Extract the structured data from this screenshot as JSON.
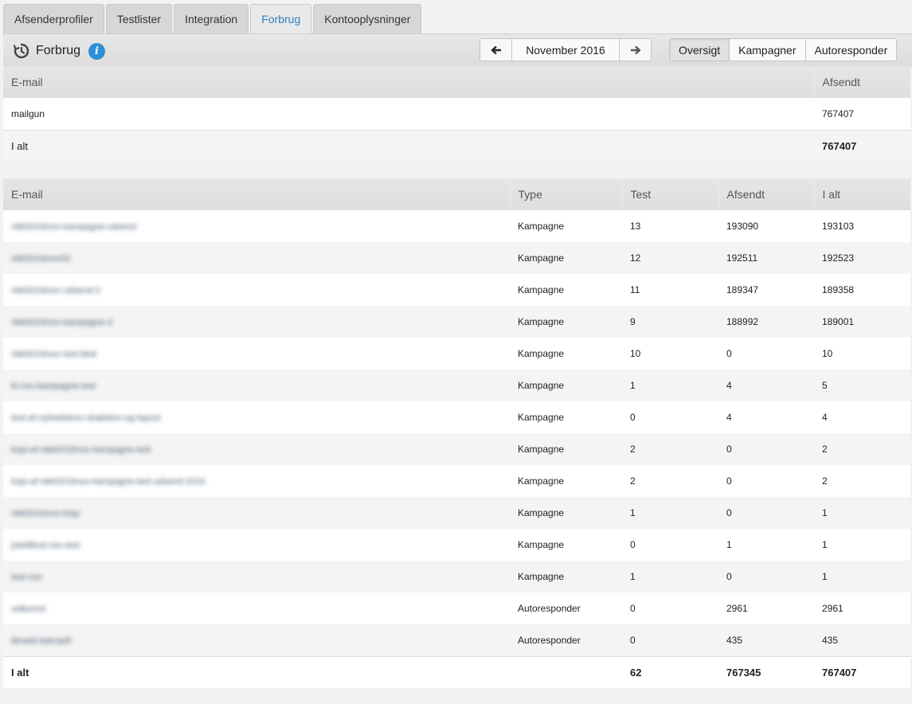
{
  "tabs": [
    {
      "label": "Afsenderprofiler",
      "active": false
    },
    {
      "label": "Testlister",
      "active": false
    },
    {
      "label": "Integration",
      "active": false
    },
    {
      "label": "Forbrug",
      "active": true
    },
    {
      "label": "Kontooplysninger",
      "active": false
    }
  ],
  "toolbar": {
    "title": "Forbrug",
    "info_icon": "i",
    "month": "November 2016",
    "prev_arrow": "🡐",
    "next_arrow": "🡒",
    "views": [
      {
        "label": "Oversigt",
        "active": true
      },
      {
        "label": "Kampagner",
        "active": false
      },
      {
        "label": "Autoresponder",
        "active": false
      }
    ]
  },
  "senders_table": {
    "headers": {
      "email": "E-mail",
      "sent": "Afsendt"
    },
    "rows": [
      {
        "email": "mailgun",
        "sent": "767407"
      }
    ],
    "total": {
      "label": "I alt",
      "sent": "767407"
    }
  },
  "usage_table": {
    "headers": {
      "email": "E-mail",
      "type": "Type",
      "test": "Test",
      "sent": "Afsendt",
      "total": "I alt"
    },
    "rows": [
      {
        "email": "nbkl2016nov-kampagne-udsend",
        "type": "Kampagne",
        "test": "13",
        "sent": "193090",
        "total": "193103"
      },
      {
        "email": "nbkl2016nov02",
        "type": "Kampagne",
        "test": "12",
        "sent": "192511",
        "total": "192523"
      },
      {
        "email": "nbkl2016nov-udsend-3",
        "type": "Kampagne",
        "test": "11",
        "sent": "189347",
        "total": "189358"
      },
      {
        "email": "nbkl2016nov-kampagne-4",
        "type": "Kampagne",
        "test": "9",
        "sent": "188992",
        "total": "189001"
      },
      {
        "email": "nbkl2016nov-test-blok",
        "type": "Kampagne",
        "test": "10",
        "sent": "0",
        "total": "10"
      },
      {
        "email": "kl-nov-kampagne-test",
        "type": "Kampagne",
        "test": "1",
        "sent": "4",
        "total": "5"
      },
      {
        "email": "test-af-nyhedsbrev-skabelon-og-layout",
        "type": "Kampagne",
        "test": "0",
        "sent": "4",
        "total": "4"
      },
      {
        "email": "kopi-af-nbkl2016nov-kampagne-test",
        "type": "Kampagne",
        "test": "2",
        "sent": "0",
        "total": "2"
      },
      {
        "email": "kopi-af-nbkl2016nov-kampagne-test-udsend-2016",
        "type": "Kampagne",
        "test": "2",
        "sent": "0",
        "total": "2"
      },
      {
        "email": "nbkl2016nov-kopi",
        "type": "Kampagne",
        "test": "1",
        "sent": "0",
        "total": "1"
      },
      {
        "email": "juletilbud-nov-test",
        "type": "Kampagne",
        "test": "0",
        "sent": "1",
        "total": "1"
      },
      {
        "email": "test-nov",
        "type": "Kampagne",
        "test": "1",
        "sent": "0",
        "total": "1"
      },
      {
        "email": "velkomst",
        "type": "Autoresponder",
        "test": "0",
        "sent": "2961",
        "total": "2961"
      },
      {
        "email": "tilmeld-bekraeft",
        "type": "Autoresponder",
        "test": "0",
        "sent": "435",
        "total": "435"
      }
    ],
    "total": {
      "label": "I alt",
      "test": "62",
      "sent": "767345",
      "total": "767407"
    }
  },
  "colors": {
    "active_tab_text": "#2a7fc4",
    "info_icon_bg": "#2d8fd6"
  }
}
